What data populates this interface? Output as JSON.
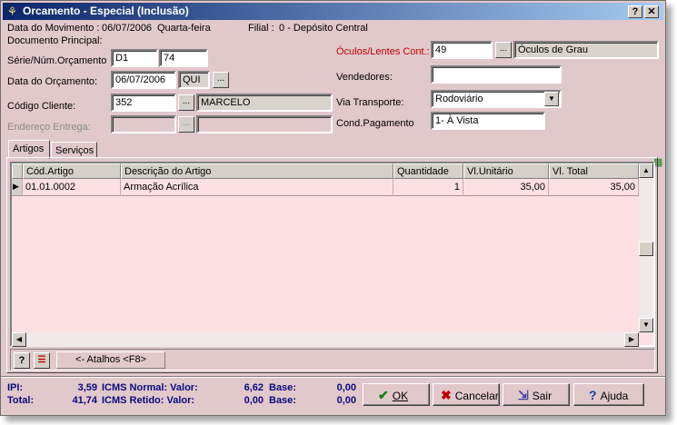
{
  "window": {
    "title": "Orcamento - Especial (Inclusão)",
    "help_btn": "?",
    "close_btn": "✕"
  },
  "header": {
    "data_mov_label": "Data do Movimento :",
    "data_mov_value": "06/07/2006",
    "weekday": "Quarta-feira",
    "filial_label": "Filial :",
    "filial_value": "0 - Depósito Central",
    "doc_principal_label": "Documento Principal:"
  },
  "form": {
    "serie_label": "Série/Núm.Orçamento",
    "serie_value": "D1",
    "numero_value": "74",
    "data_orc_label": "Data do Orçamento:",
    "data_orc_value": "06/07/2006",
    "dia_value": "QUI",
    "codigo_label": "Código Cliente:",
    "codigo_value": "352",
    "cliente_nome": "MARCELO",
    "endereco_label": "Endereço Entrega:",
    "oculos_label": "Óculos/Lentes Cont.:",
    "oculos_value": "49",
    "oculos_desc": "Óculos de Grau",
    "vendedores_label": "Vendedores:",
    "via_label": "Via Transporte:",
    "via_value": "Rodoviário",
    "cond_label": "Cond.Pagamento",
    "cond_value": "1- À Vista",
    "ellipsis": "..."
  },
  "tabs": [
    {
      "label": "Artigos"
    },
    {
      "label": "Serviços"
    }
  ],
  "grid": {
    "columns": [
      "Cód.Artigo",
      "Descrição do Artigo",
      "Quantidade",
      "Vl.Unitário",
      "Vl. Total"
    ],
    "rows": [
      {
        "codigo": "01.01.0002",
        "descricao": "Armação Acrílica",
        "quantidade": "1",
        "unitario": "35,00",
        "total": "35,00"
      }
    ]
  },
  "toolbar": {
    "atalhos": "<- Atalhos <F8>"
  },
  "totals": {
    "ipi_label": "IPI:",
    "ipi_value": "3,59",
    "total_label": "Total:",
    "total_value": "41,74",
    "icms_normal_label": "ICMS Normal: Valor:",
    "icms_normal_value": "6,62",
    "icms_retido_label": "ICMS Retido: Valor:",
    "icms_retido_value": "0,00",
    "base_label": "Base:",
    "base_normal": "0,00",
    "base_retido": "0,00"
  },
  "actions": {
    "ok": "OK",
    "cancelar": "Cancelar",
    "sair": "Sair",
    "ajuda": "Ajuda"
  },
  "colors": {
    "window_bg": "#e1c8cb",
    "grid_bg": "#fde0e2",
    "title_from": "#0a246a",
    "title_to": "#a6caf0",
    "totals_text": "#0a0a80"
  }
}
